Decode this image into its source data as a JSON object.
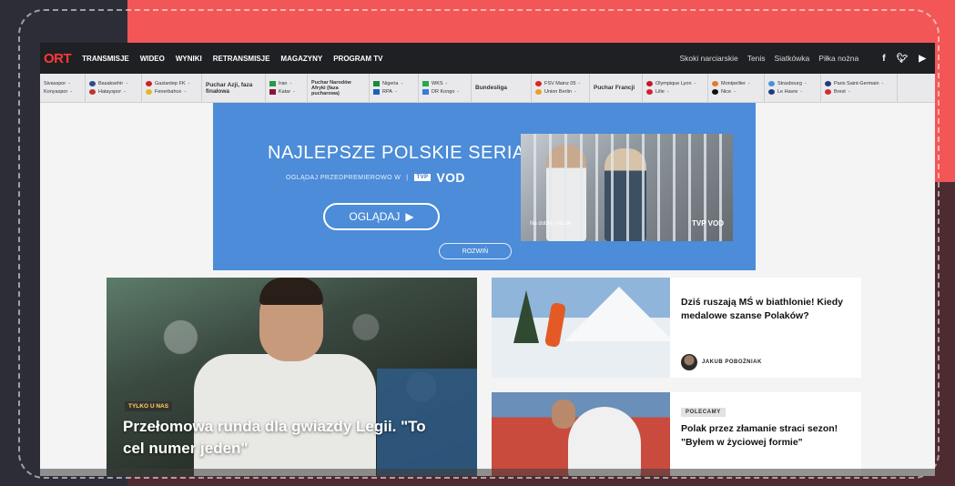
{
  "colors": {
    "accent": "#f25656",
    "brand": "#ff3838",
    "ad_blue": "#4c8cd8"
  },
  "nav": {
    "brand": "ORT",
    "items": [
      "TRANSMISJE",
      "WIDEO",
      "WYNIKI",
      "RETRANSMISJE",
      "MAGAZYNY",
      "PROGRAM TV"
    ],
    "right": [
      "Skoki narciarskie",
      "Tenis",
      "Siatkówka",
      "Piłka nożna"
    ],
    "social": [
      "facebook-icon",
      "twitter-icon",
      "youtube-icon"
    ]
  },
  "matches": [
    {
      "home": "Sivasspor",
      "home_score": "-",
      "away": "Konyaspor",
      "away_score": "-"
    },
    {
      "home": "Basaksehir",
      "home_score": "-",
      "away": "Hatayspor",
      "away_score": "-"
    },
    {
      "home": "Gaziantep FK",
      "home_score": "-",
      "away": "Fenerbahce",
      "away_score": "-"
    },
    {
      "label": "Puchar Azji, faza finałowa"
    },
    {
      "home": "Iran",
      "home_score": "-",
      "away": "Katar",
      "away_score": "-"
    },
    {
      "label": "Puchar Narodów Afryki (faza pucharowa)"
    },
    {
      "home": "Nigeria",
      "home_score": "-",
      "away": "RPA",
      "away_score": "-"
    },
    {
      "home": "WKS",
      "home_score": "-",
      "away": "DR Kongo",
      "away_score": "-"
    },
    {
      "label": "Bundesliga"
    },
    {
      "home": "FSV Mainz 05",
      "home_score": "-",
      "away": "Union Berlin",
      "away_score": "-"
    },
    {
      "label": "Puchar Francji"
    },
    {
      "home": "Olympique Lyon",
      "home_score": "-",
      "away": "Lille",
      "away_score": "-"
    },
    {
      "home": "Montpellier",
      "home_score": "-",
      "away": "Nice",
      "away_score": "-"
    },
    {
      "home": "Strasbourg",
      "home_score": "-",
      "away": "Le Havre",
      "away_score": "-"
    },
    {
      "home": "Paris Saint-Germain",
      "home_score": "-",
      "away": "Brest",
      "away_score": "-"
    }
  ],
  "ad": {
    "title": "NAJLEPSZE POLSKIE SERIALE",
    "subtitle": "OGLĄDAJ PRZEDPREMIEROWO W",
    "tvp": "TVP",
    "vod": "VOD",
    "button": "OGLĄDAJ",
    "expand": "ROZWIŃ",
    "caption": "Na dobre i na złe",
    "logo": "TVP VOD"
  },
  "hero": {
    "tag": "TYLKO U NAS",
    "title": "Przełomowa runda dla gwiazdy Legii. \"To cel numer jeden\""
  },
  "articles": [
    {
      "title": "Dziś ruszają MŚ w biathlonie! Kiedy medalowe szanse Polaków?",
      "author": "JAKUB POBOŻNIAK"
    },
    {
      "badge": "POLECAMY",
      "title": "Polak przez złamanie straci sezon! \"Byłem w życiowej formie\""
    }
  ]
}
